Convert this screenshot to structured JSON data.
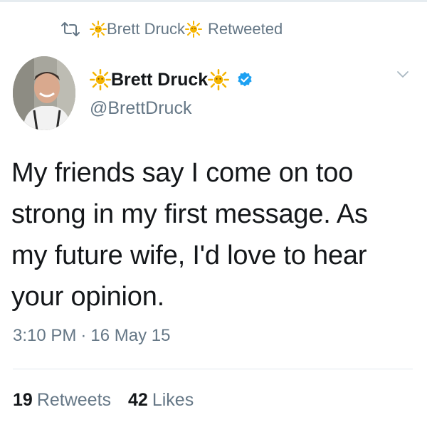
{
  "retweet_context": {
    "icon": "retweet-icon",
    "retweeter_name": "Brett Druck",
    "retweeter_emoji": "sun-emoji",
    "label": "Retweeted"
  },
  "author": {
    "display_name": "Brett Druck",
    "name_emoji": "sun-emoji",
    "verified": true,
    "handle": "@BrettDruck",
    "avatar": "profile-photo"
  },
  "tweet": {
    "lines": [
      "My friends say I come on too",
      "strong in my first message. As",
      "my future wife, I'd love to hear",
      "your opinion."
    ],
    "time": "3:10 PM",
    "separator": "·",
    "date": "16 May 15"
  },
  "stats": {
    "retweets_count": "19",
    "retweets_label": "Retweets",
    "likes_count": "42",
    "likes_label": "Likes"
  },
  "colors": {
    "primary_text": "#14171a",
    "secondary_text": "#657786",
    "verified_blue": "#1da1f2",
    "sun_yellow": "#f5b400"
  }
}
